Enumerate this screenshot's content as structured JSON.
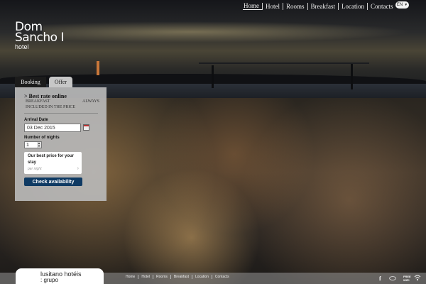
{
  "nav": {
    "items": [
      "Home",
      "Hotel",
      "Rooms",
      "Breakfast",
      "Location",
      "Contacts"
    ],
    "active": "Home",
    "language": "EN"
  },
  "logo": {
    "line1": "Dom",
    "line2": "Sancho I",
    "line3": "hotel"
  },
  "booking": {
    "tab_booking": "Booking",
    "tab_offer": "Offer",
    "offer_title": "> Best rate online",
    "offer_line1_left": "BREAKFAST",
    "offer_line1_right": "ALWAYS",
    "offer_line2": "INCLUDED IN THE PRICE",
    "arrival_label": "Arrival Date",
    "arrival_value": "03 Dec 2015",
    "nights_label": "Number of nights",
    "nights_value": "1",
    "price_title": "Our best price for your stay",
    "price_note": "per night",
    "check_button": "Check availability"
  },
  "footer": {
    "brand_line1": "lusitano hotéis",
    "brand_line2": ": grupo",
    "links": [
      "Home",
      "Hotel",
      "Rooms",
      "Breakfast",
      "Location",
      "Contacts"
    ],
    "facebook": "f",
    "wifi_line1": "FREE",
    "wifi_line2": "WIFI"
  },
  "colors": {
    "button": "#0f3a63",
    "panel": "#b9b9b9"
  }
}
